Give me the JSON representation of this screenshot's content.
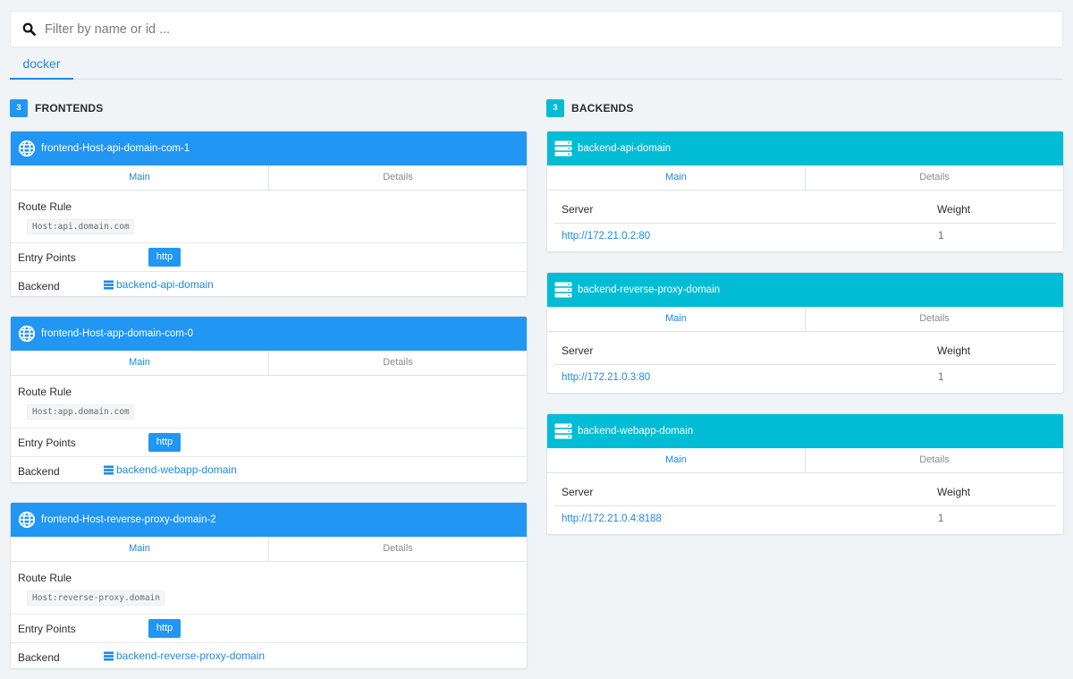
{
  "search": {
    "placeholder": "Filter by name or id ..."
  },
  "provider_tabs": [
    {
      "label": "docker"
    }
  ],
  "frontends_section": {
    "count": "3",
    "title": "FRONTENDS"
  },
  "backends_section": {
    "count": "3",
    "title": "BACKENDS"
  },
  "labels": {
    "main": "Main",
    "details": "Details",
    "route_rule": "Route Rule",
    "entry_points": "Entry Points",
    "backend": "Backend",
    "server": "Server",
    "weight": "Weight"
  },
  "frontends": [
    {
      "name": "frontend-Host-api-domain-com-1",
      "route": "Host:api.domain.com",
      "entry_point": "http",
      "backend": "backend-api-domain"
    },
    {
      "name": "frontend-Host-app-domain-com-0",
      "route": "Host:app.domain.com",
      "entry_point": "http",
      "backend": "backend-webapp-domain"
    },
    {
      "name": "frontend-Host-reverse-proxy-domain-2",
      "route": "Host:reverse-proxy.domain",
      "entry_point": "http",
      "backend": "backend-reverse-proxy-domain"
    }
  ],
  "backends": [
    {
      "name": "backend-api-domain",
      "server": "http://172.21.0.2:80",
      "weight": "1"
    },
    {
      "name": "backend-reverse-proxy-domain",
      "server": "http://172.21.0.3:80",
      "weight": "1"
    },
    {
      "name": "backend-webapp-domain",
      "server": "http://172.21.0.4:8188",
      "weight": "1"
    }
  ],
  "colors": {
    "frontend_header": "#2196f3",
    "backend_header": "#00bcd4",
    "link": "#1e88e5",
    "background": "#f1f4f7"
  }
}
